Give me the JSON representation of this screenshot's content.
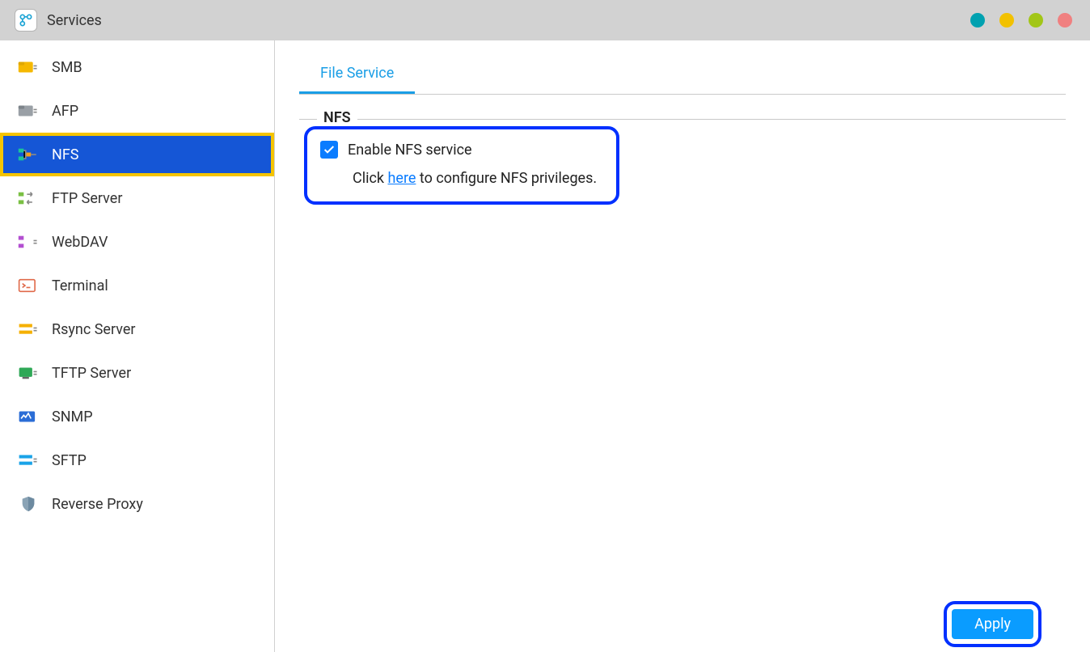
{
  "window": {
    "title": "Services"
  },
  "sidebar": {
    "items": [
      {
        "label": "SMB",
        "selected": false
      },
      {
        "label": "AFP",
        "selected": false
      },
      {
        "label": "NFS",
        "selected": true
      },
      {
        "label": "FTP Server",
        "selected": false
      },
      {
        "label": "WebDAV",
        "selected": false
      },
      {
        "label": "Terminal",
        "selected": false
      },
      {
        "label": "Rsync Server",
        "selected": false
      },
      {
        "label": "TFTP Server",
        "selected": false
      },
      {
        "label": "SNMP",
        "selected": false
      },
      {
        "label": "SFTP",
        "selected": false
      },
      {
        "label": "Reverse Proxy",
        "selected": false
      }
    ]
  },
  "main": {
    "tab_label": "File Service",
    "group_title": "NFS",
    "checkbox_label": "Enable NFS service",
    "checkbox_checked": true,
    "hint_prefix": "Click ",
    "hint_link": "here",
    "hint_suffix": " to configure NFS privileges."
  },
  "footer": {
    "apply_label": "Apply"
  }
}
